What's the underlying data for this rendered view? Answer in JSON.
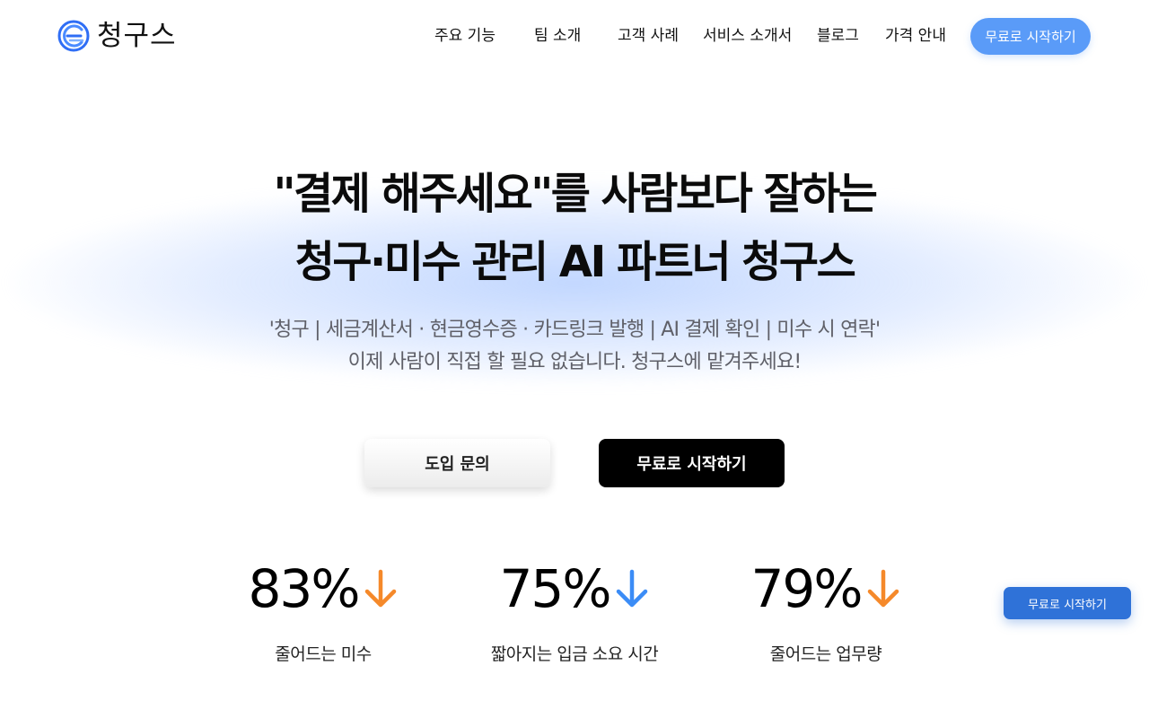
{
  "brand": {
    "name": "청구스"
  },
  "nav": {
    "items": [
      "주요 기능",
      "팀 소개",
      "고객 사례",
      "서비스 소개서",
      "블로그",
      "가격 안내"
    ],
    "cta": "무료로 시작하기"
  },
  "hero": {
    "headline_line1": "\"결제 해주세요\"를 사람보다 잘하는",
    "headline_line2": "청구·미수 관리 AI 파트너 청구스",
    "sub_line1": "'청구 | 세금계산서 · 현금영수증 · 카드링크 발행 | AI 결제 확인 |  미수 시 연락'",
    "sub_line2": "이제 사람이 직접 할 필요 없습니다. 청구스에 맡겨주세요!",
    "inquiry_button": "도입 문의",
    "start_button": "무료로 시작하기"
  },
  "stats": [
    {
      "value": "83%",
      "label": "줄어드는 미수",
      "arrow_icon": "arrow-down-icon",
      "arrow_color": "#f5892a"
    },
    {
      "value": "75%",
      "label": "짧아지는 입금 소요 시간",
      "arrow_icon": "arrow-down-icon",
      "arrow_color": "#3b8cf6"
    },
    {
      "value": "79%",
      "label": "줄어드는 업무량",
      "arrow_icon": "arrow-down-icon",
      "arrow_color": "#f5892a"
    }
  ],
  "floating_cta": "무료로 시작하기",
  "colors": {
    "nav_cta": "#5a9bf8",
    "floating_cta": "#2f72d8",
    "primary_button": "#000000",
    "logo_blue": "#2f6ef5"
  }
}
